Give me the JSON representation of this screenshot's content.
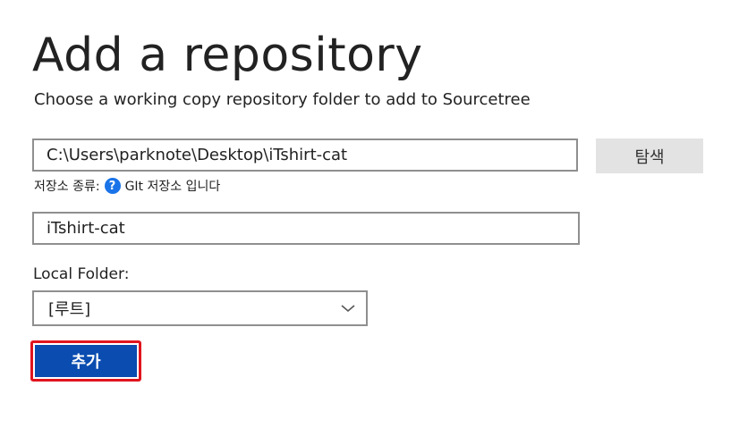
{
  "header": {
    "title": "Add a repository",
    "subtitle": "Choose a working copy repository folder to add to Sourcetree"
  },
  "path_field": {
    "value": "C:\\Users\\parknote\\Desktop\\iTshirt-cat"
  },
  "browse_button": {
    "label": "탐색"
  },
  "repo_type": {
    "label": "저장소 종류:",
    "help_icon": "question-circle-icon",
    "help_glyph": "?",
    "value": "GIt 저장소 입니다"
  },
  "name_field": {
    "value": "iTshirt-cat"
  },
  "local_folder": {
    "label": "Local Folder:",
    "selected": "[루트]",
    "icon": "chevron-down-icon"
  },
  "add_button": {
    "label": "추가",
    "highlight_color": "#e0141e",
    "color": "#0a4cb0"
  }
}
